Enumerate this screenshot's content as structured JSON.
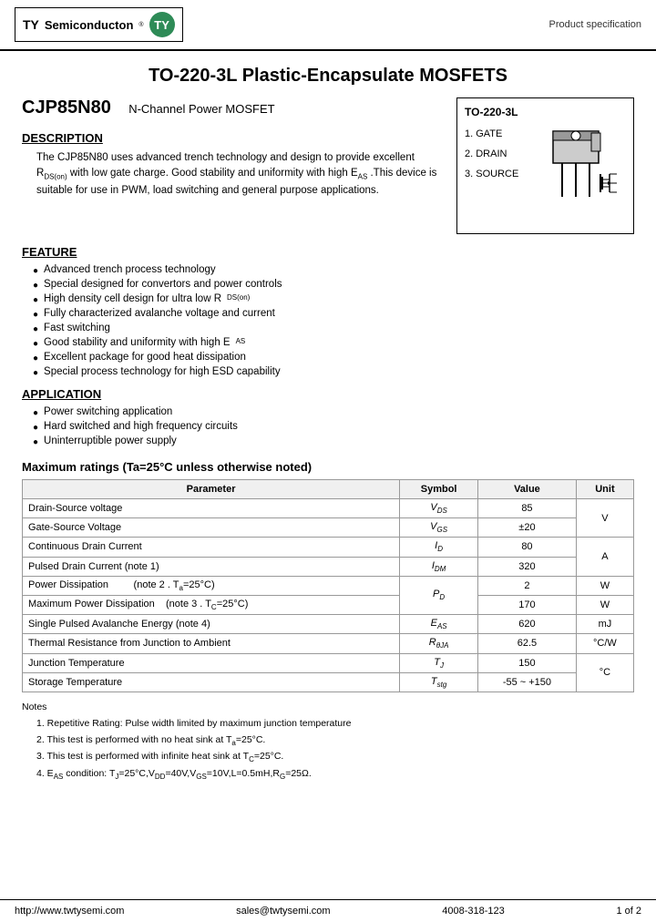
{
  "header": {
    "logo_ty": "TY",
    "brand": "Semiconducton",
    "logo_circle": "TY",
    "product_spec": "Product specification"
  },
  "page_title": "TO-220-3L Plastic-Encapsulate MOSFETS",
  "part": {
    "number": "CJP85N80",
    "type": "N-Channel Power MOSFET"
  },
  "diagram": {
    "title": "TO-220-3L",
    "pin1": "1. GATE",
    "pin2": "2. DRAIN",
    "pin3": "3. SOURCE"
  },
  "description": {
    "title": "DESCRIPTION",
    "text": "The CJP85N80 uses advanced trench technology and design to provide excellent R₂ₛ(ₒₙ) with low gate charge. Good stability and uniformity with high Eₐₛ .This device is suitable for use in PWM, load switching and general purpose applications."
  },
  "feature": {
    "title": "FEATURE",
    "items": [
      "Advanced trench process technology",
      "Special designed for convertors and power controls",
      "High density cell design for ultra low RDS(on)",
      "Fully characterized avalanche voltage and current",
      "Fast switching",
      "Good stability and uniformity with high EAS",
      "Excellent package for good heat dissipation",
      "Special process technology for high ESD capability"
    ]
  },
  "application": {
    "title": "APPLICATION",
    "items": [
      "Power switching application",
      "Hard switched and high frequency circuits",
      "Uninterruptible power supply"
    ]
  },
  "max_ratings": {
    "title": "Maximum ratings (Ta=25°C unless otherwise noted)",
    "columns": [
      "Parameter",
      "Symbol",
      "Value",
      "Unit"
    ],
    "rows": [
      {
        "param": "Drain-Source voltage",
        "symbol": "VDS",
        "value": "85",
        "unit": "V",
        "rowspan": 1
      },
      {
        "param": "Gate-Source Voltage",
        "symbol": "VGS",
        "value": "±20",
        "unit": "",
        "rowspan": 1
      },
      {
        "param": "Continuous Drain Current",
        "symbol": "ID",
        "value": "80",
        "unit": "A",
        "rowspan": 1
      },
      {
        "param": "Pulsed Drain Current (note 1)",
        "symbol": "IDM",
        "value": "320",
        "unit": "",
        "rowspan": 1
      },
      {
        "param": "Power Dissipation        (note 2 . Ta=25°C)",
        "symbol": "PD",
        "value": "2",
        "unit": "W",
        "rowspan": 1
      },
      {
        "param": "Maximum Power Dissipation    (note 3 . TC=25°C)",
        "symbol": "",
        "value": "170",
        "unit": "W",
        "rowspan": 1
      },
      {
        "param": "Single Pulsed Avalanche Energy (note 4)",
        "symbol": "EAS",
        "value": "620",
        "unit": "mJ",
        "rowspan": 1
      },
      {
        "param": "Thermal Resistance from Junction to Ambient",
        "symbol": "RθJA",
        "value": "62.5",
        "unit": "°C/W",
        "rowspan": 1
      },
      {
        "param": "Junction Temperature",
        "symbol": "TJ",
        "value": "150",
        "unit": "°C",
        "rowspan": 1
      },
      {
        "param": "Storage Temperature",
        "symbol": "Tstg",
        "value": "-55 ~ +150",
        "unit": "",
        "rowspan": 1
      }
    ]
  },
  "notes": {
    "title": "Notes",
    "items": [
      "1. Repetitive Rating: Pulse width limited by maximum junction temperature",
      "2. This test is performed with no heat sink at Ta=25°C.",
      "3. This test is performed with infinite heat sink at TC=25°C.",
      "4. EAS condition: TJ=25°C,VDD=40V,VGS=10V,L=0.5mH,RG=25Ω."
    ]
  },
  "footer": {
    "website": "http://www.twtysemi.com",
    "email": "sales@twtysemi.com",
    "phone": "4008-318-123",
    "page": "1 of 2"
  }
}
